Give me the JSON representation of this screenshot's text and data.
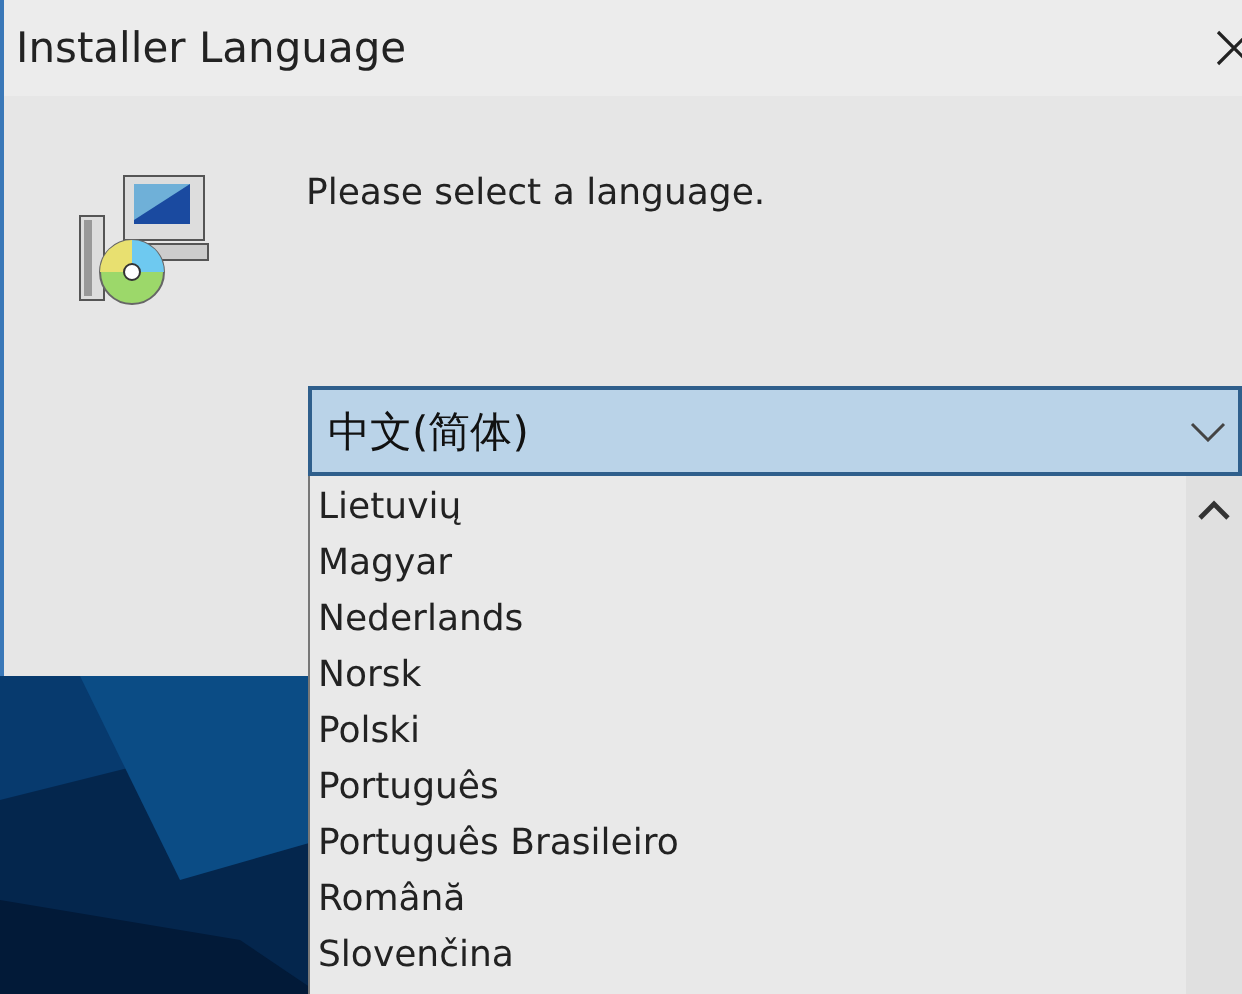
{
  "window": {
    "title": "Installer Language"
  },
  "prompt": "Please select a language.",
  "language_select": {
    "value": "中文(简体)",
    "expanded": true
  },
  "options": [
    {
      "label": "Lietuvių",
      "selected": false
    },
    {
      "label": "Magyar",
      "selected": false
    },
    {
      "label": "Nederlands",
      "selected": false
    },
    {
      "label": "Norsk",
      "selected": false
    },
    {
      "label": "Polski",
      "selected": false
    },
    {
      "label": "Português",
      "selected": false
    },
    {
      "label": "Português Brasileiro",
      "selected": false
    },
    {
      "label": "Română",
      "selected": false
    },
    {
      "label": "Slovenčina",
      "selected": false
    }
  ]
}
